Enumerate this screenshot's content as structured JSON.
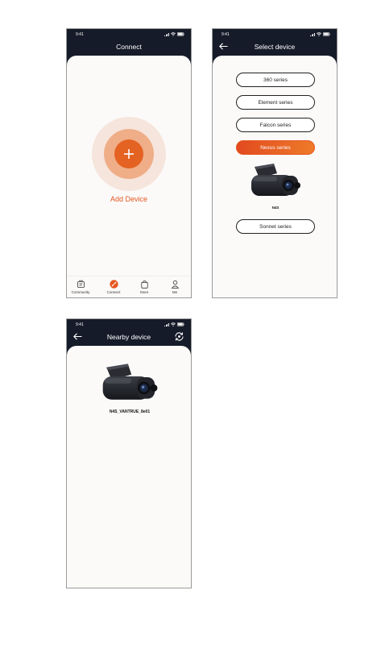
{
  "screen_connect": {
    "status_time": "9:41",
    "title": "Connect",
    "add_label": "Add Device",
    "nav": [
      {
        "label": "Community",
        "icon": "community-icon"
      },
      {
        "label": "Connect",
        "icon": "connect-icon"
      },
      {
        "label": "Store",
        "icon": "store-icon"
      },
      {
        "label": "Me",
        "icon": "me-icon"
      }
    ]
  },
  "screen_select": {
    "status_time": "9:41",
    "title": "Select device",
    "series": [
      "360 series",
      "Element series",
      "Falcon series",
      "Nexus series",
      "Sonnet series"
    ],
    "selected_series": "Nexus series",
    "product_label": "N4S"
  },
  "screen_nearby": {
    "status_time": "9:41",
    "title": "Nearby device",
    "device_name": "N4S_VANTRUE_8e01"
  },
  "colors": {
    "header_bg": "#161b29",
    "card_bg": "#fbfaf9",
    "accent": "#e5571f",
    "accent_light": "#f0a478"
  }
}
